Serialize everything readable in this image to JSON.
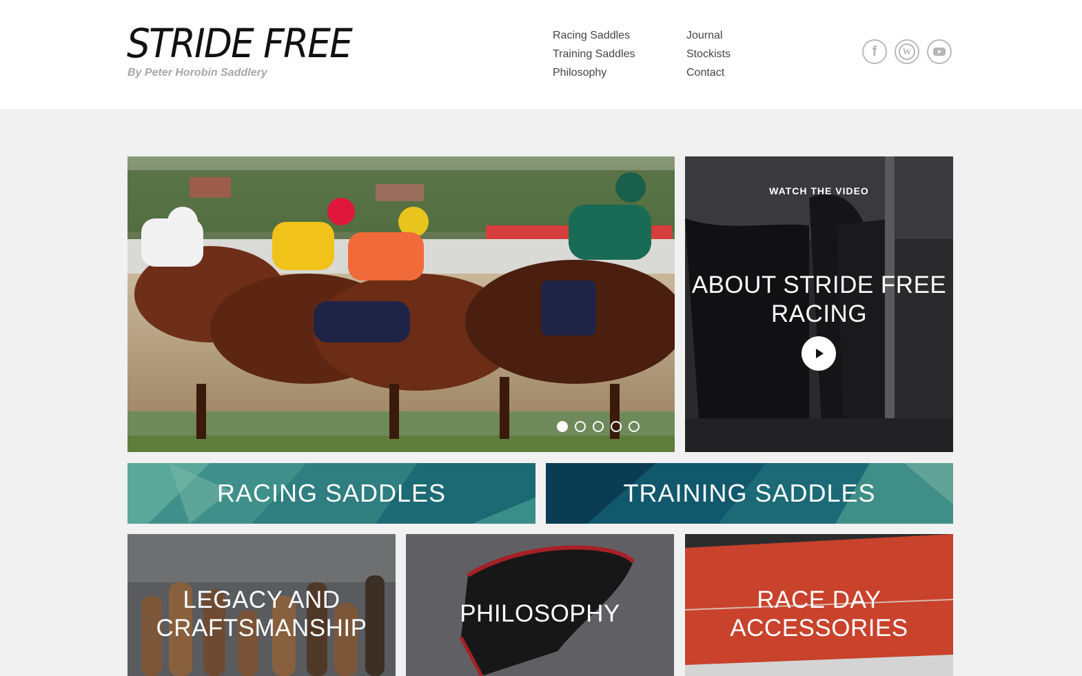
{
  "brand": {
    "name": "STRIDE FREE",
    "byline": "By Peter Horobin Saddlery"
  },
  "nav": {
    "col1": [
      "Racing Saddles",
      "Training Saddles",
      "Philosophy"
    ],
    "col2": [
      "Journal",
      "Stockists",
      "Contact"
    ]
  },
  "social": {
    "icons": [
      "facebook-icon",
      "wordpress-icon",
      "youtube-icon"
    ],
    "facebook_glyph": "f",
    "wordpress_glyph": "W"
  },
  "hero": {
    "slide_count": 5,
    "active_slide": 1
  },
  "video": {
    "kicker": "WATCH THE VIDEO",
    "title": "ABOUT STRIDE FREE RACING"
  },
  "banners": {
    "racing": "RACING SADDLES",
    "training": "TRAINING SADDLES"
  },
  "tiles": {
    "legacy": "LEGACY AND CRAFTSMANSHIP",
    "philosophy": "PHILOSOPHY",
    "accessories": "RACE DAY ACCESSORIES"
  },
  "colors": {
    "teal_light": "#4a9b91",
    "teal_dark": "#0f4d63",
    "accessories_red": "#e1442a"
  }
}
